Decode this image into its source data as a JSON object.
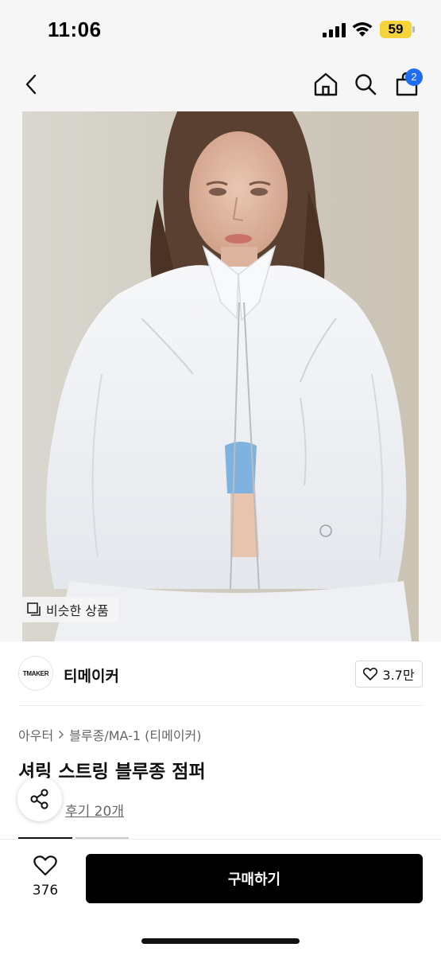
{
  "status_bar": {
    "time": "11:06",
    "battery": "59"
  },
  "nav": {
    "cart_count": "2",
    "icons": [
      "back-icon",
      "home-icon",
      "search-icon",
      "cart-icon"
    ]
  },
  "image": {
    "similar_label": "비슷한 상품"
  },
  "brand": {
    "logo_text": "TMAKER",
    "name": "티메이커",
    "likes": "3.7만"
  },
  "product": {
    "category_1": "아우터",
    "category_2": "블루종/MA-1 (티메이커)",
    "title": "셔링 스트링 블루종 점퍼",
    "review_link": "후기 20개"
  },
  "bottom_bar": {
    "wish_count": "376",
    "buy_label": "구매하기"
  },
  "colors": {
    "accent_blue": "#1f6cf5",
    "buy_button": "#000000",
    "battery": "#f4d43a"
  }
}
